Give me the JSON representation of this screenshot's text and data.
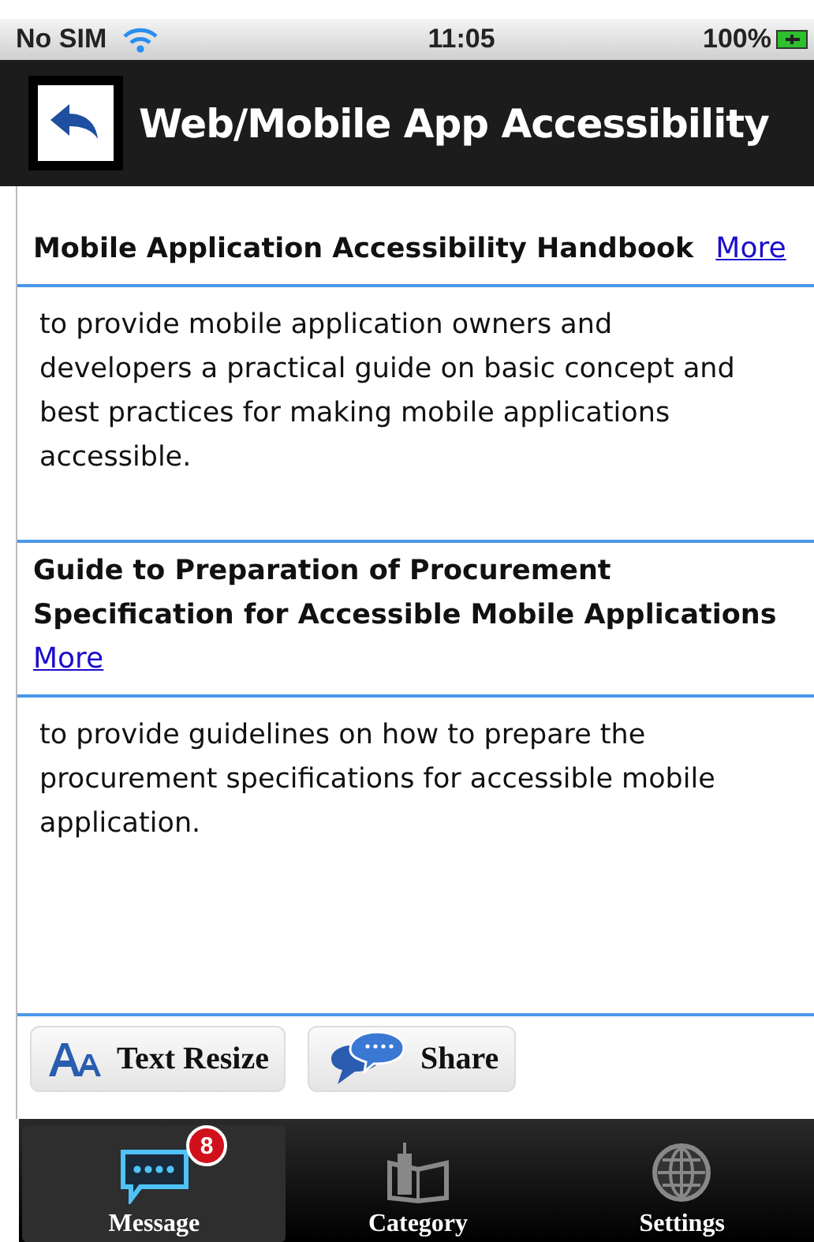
{
  "status_bar": {
    "carrier": "No SIM",
    "time": "11:05",
    "battery": "100%"
  },
  "header": {
    "title": "Web/Mobile App Accessibility"
  },
  "articles": [
    {
      "title": "Mobile Application Accessibility Handbook",
      "link": "More",
      "inline_link": true,
      "description": "to provide mobile application owners and developers a practical guide on basic concept and best practices for making mobile applications accessible."
    },
    {
      "title": "Guide to Preparation of Procurement Specification for Accessible Mobile Applications",
      "link": "More",
      "inline_link": false,
      "description": "to provide guidelines on how to prepare the procurement specifications for accessible mobile application."
    }
  ],
  "actions": [
    {
      "kind": "resize",
      "label": "Text Resize"
    },
    {
      "kind": "share",
      "label": "Share"
    }
  ],
  "tabs": [
    {
      "kind": "message",
      "label": "Message",
      "selected": true,
      "badge": "8"
    },
    {
      "kind": "category",
      "label": "Category",
      "selected": false
    },
    {
      "kind": "settings",
      "label": "Settings",
      "selected": false
    }
  ]
}
